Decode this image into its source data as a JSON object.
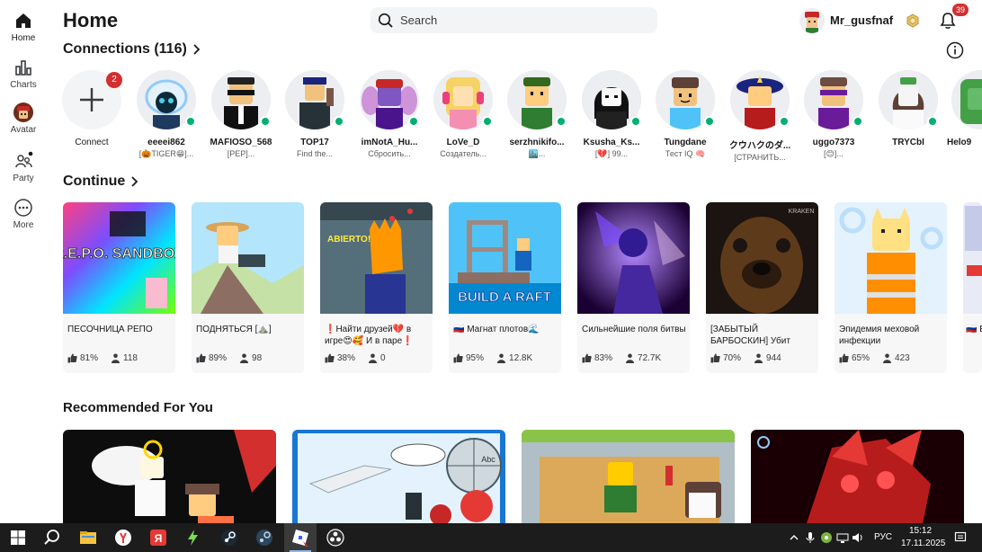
{
  "nav": {
    "items": [
      {
        "label": "Home",
        "icon": "home-icon"
      },
      {
        "label": "Charts",
        "icon": "charts-icon"
      },
      {
        "label": "Avatar",
        "icon": "avatar-icon"
      },
      {
        "label": "Party",
        "icon": "party-icon"
      },
      {
        "label": "More",
        "icon": "more-icon"
      }
    ]
  },
  "header": {
    "title": "Home",
    "search_placeholder": "Search",
    "username": "Mr_gusfnaf",
    "notification_count": "39"
  },
  "connections": {
    "title": "Connections (116)",
    "add": {
      "label": "Connect",
      "badge": "2"
    },
    "people": [
      {
        "name": "eeeei862",
        "status": "[🎃TIGER😁]..."
      },
      {
        "name": "MAFIOSO_568",
        "status": "[PEP]..."
      },
      {
        "name": "TOP17",
        "status": "Find the..."
      },
      {
        "name": "imNotA_Hu...",
        "status": "Сбросить..."
      },
      {
        "name": "LoVe_D",
        "status": "Создатель..."
      },
      {
        "name": "serzhnikifo...",
        "status": "🏙️..."
      },
      {
        "name": "Ksusha_Ks...",
        "status": "[💔] 99..."
      },
      {
        "name": "Tungdane",
        "status": "Тест IQ 🧠"
      },
      {
        "name": "クウハクのダ...",
        "status": "[СТРАНИТЬ..."
      },
      {
        "name": "uggo7373",
        "status": "[😊]..."
      },
      {
        "name": "TRYCbI",
        "status": ""
      },
      {
        "name": "Helo9",
        "status": ""
      }
    ]
  },
  "continue": {
    "title": "Continue",
    "games": [
      {
        "title": "ПЕСОЧНИЦА РЕПО",
        "rating": "81%",
        "players": "118",
        "thumb_text": "R.E.P.O. SANDBOX"
      },
      {
        "title": "ПОДНЯТЬСЯ [⛰️]",
        "rating": "89%",
        "players": "98",
        "thumb_text": ""
      },
      {
        "title": "❗Найти друзей💔 в игре😍🥰 И в паре❗",
        "rating": "38%",
        "players": "0",
        "thumb_text": "ABIERTO!"
      },
      {
        "title": "🇷🇺 Магнат плотов🌊",
        "rating": "95%",
        "players": "12.8K",
        "thumb_text": "BUILD A RAFT"
      },
      {
        "title": "Сильнейшие поля битвы",
        "rating": "83%",
        "players": "72.7K",
        "thumb_text": ""
      },
      {
        "title": "[ЗАБЫТЫЙ БАРБОСКИН] Убит",
        "rating": "70%",
        "players": "944",
        "thumb_text": "KRAKEN"
      },
      {
        "title": "Эпидемия меховой инфекции",
        "rating": "65%",
        "players": "423",
        "thumb_text": ""
      },
      {
        "title": "🇷🇺 Бе",
        "rating": "",
        "players": "",
        "thumb_text": ""
      }
    ]
  },
  "recommended": {
    "title": "Recommended For You",
    "tiles": [
      {
        "thumb_text": ""
      },
      {
        "thumb_text": "Abc"
      },
      {
        "thumb_text": ""
      },
      {
        "thumb_text": ""
      }
    ]
  },
  "taskbar": {
    "language": "РУС",
    "time": "15:12",
    "date": "17.11.2025"
  },
  "colors": {
    "accent_online": "#00b06f",
    "badge_red": "#d32f2f",
    "taskbar": "#1c1c1c"
  }
}
